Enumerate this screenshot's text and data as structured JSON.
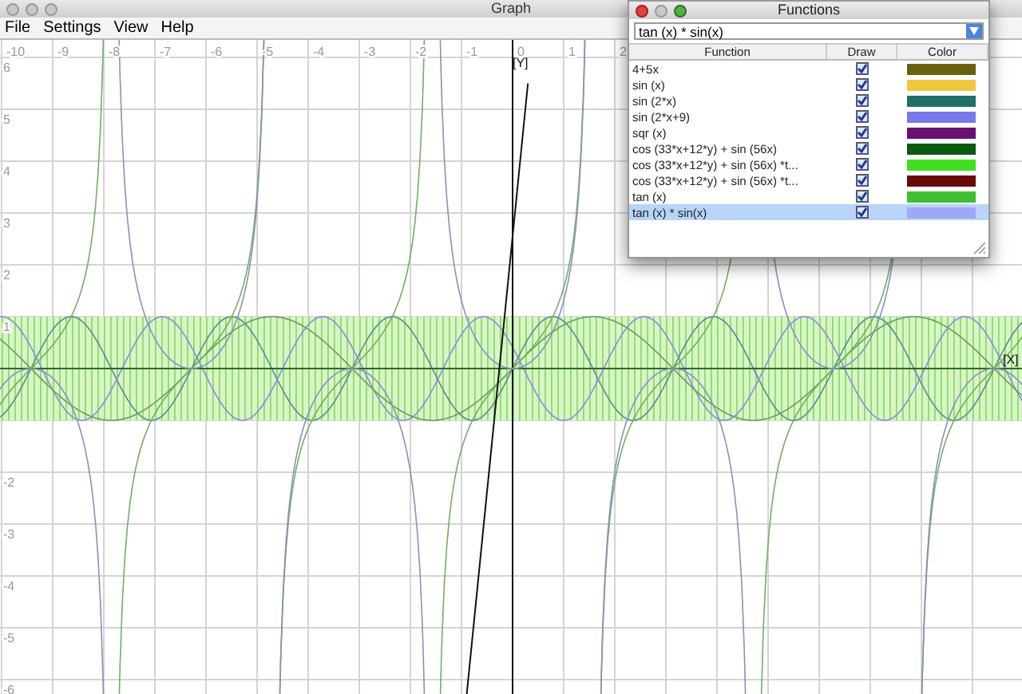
{
  "graph_window": {
    "title": "Graph",
    "menu": [
      "File",
      "Settings",
      "View",
      "Help"
    ],
    "x_tick_labels": [
      "-10",
      "-9",
      "-8",
      "-7",
      "-6",
      "-5",
      "-4",
      "-3",
      "-2",
      "-1",
      "0",
      "1",
      "2"
    ],
    "y_tick_labels_upper": [
      "6",
      "5",
      "4",
      "3",
      "2",
      "1"
    ],
    "y_tick_labels_lower": [
      "-2",
      "-3",
      "-4",
      "-5",
      "-6"
    ],
    "y_axis_label": "[Y]",
    "x_axis_label": "[X]"
  },
  "functions_window": {
    "title": "Functions",
    "expression": "tan (x) * sin(x)",
    "columns": [
      "Function",
      "Draw",
      "Color"
    ],
    "functions": [
      {
        "name": "4+5x",
        "draw": true,
        "color": "#6b6010",
        "selected": false
      },
      {
        "name": "sin (x)",
        "draw": true,
        "color": "#f0c840",
        "selected": false
      },
      {
        "name": "sin (2*x)",
        "draw": true,
        "color": "#207068",
        "selected": false
      },
      {
        "name": "sin (2*x+9)",
        "draw": true,
        "color": "#7878e8",
        "selected": false
      },
      {
        "name": "sqr (x)",
        "draw": true,
        "color": "#6a1070",
        "selected": false
      },
      {
        "name": "cos (33*x+12*y) + sin (56x)",
        "draw": true,
        "color": "#0a5a10",
        "selected": false
      },
      {
        "name": "cos (33*x+12*y) + sin (56x) *t...",
        "draw": true,
        "color": "#40e020",
        "selected": false
      },
      {
        "name": "cos (33*x+12*y) + sin (56x) *t...",
        "draw": true,
        "color": "#6a0a08",
        "selected": false
      },
      {
        "name": "tan (x)",
        "draw": true,
        "color": "#40c030",
        "selected": false
      },
      {
        "name": "tan (x) * sin(x)",
        "draw": true,
        "color": "#a0a8f8",
        "selected": true
      }
    ]
  }
}
